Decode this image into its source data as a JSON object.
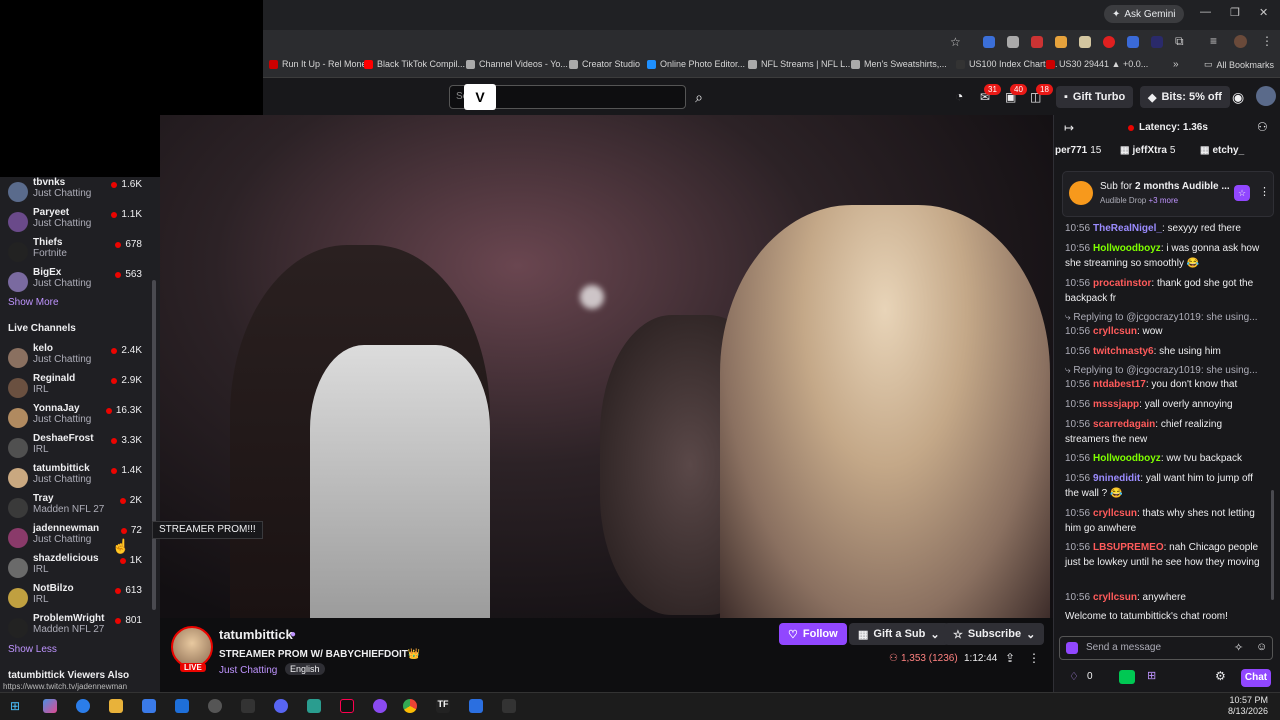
{
  "browser": {
    "gemini_label": "Ask Gemini",
    "bookmarks": [
      {
        "label": "Run It Up - Rel Money",
        "color": "#cc0000"
      },
      {
        "label": "Black TikTok Compil...",
        "color": "#ff0000"
      },
      {
        "label": "Channel Videos - Yo...",
        "color": "#aaaaaa"
      },
      {
        "label": "Creator Studio",
        "color": "#aaaaaa"
      },
      {
        "label": "Online Photo Editor...",
        "color": "#1e90ff"
      },
      {
        "label": "NFL Streams | NFL L...",
        "color": "#aaaaaa"
      },
      {
        "label": "Men's Sweatshirts,...",
        "color": "#aaaaaa"
      },
      {
        "label": "US100 Index Charts...",
        "color": "#333333"
      },
      {
        "label": "US30 29441 ▲ +0.0...",
        "color": "#cc0000"
      }
    ],
    "all_bookmarks": "All Bookmarks",
    "status_url": "https://www.twitch.tv/jadennewman"
  },
  "topnav": {
    "search_placeholder": "Search",
    "badges": [
      "31",
      "40",
      "18"
    ],
    "gift_turbo": "Gift Turbo",
    "bits": "Bits: 5% off"
  },
  "sidebar": {
    "followed": [
      {
        "name": "tbvnks",
        "game": "Just Chatting",
        "viewers": "1.6K",
        "color": "#5a6b8c"
      },
      {
        "name": "Paryeet",
        "game": "Just Chatting",
        "viewers": "1.1K",
        "color": "#6a4a8a"
      },
      {
        "name": "Thiefs",
        "game": "Fortnite",
        "viewers": "678",
        "color": "#222222"
      },
      {
        "name": "BigEx",
        "game": "Just Chatting",
        "viewers": "563",
        "color": "#7a6aa0"
      }
    ],
    "show_more": "Show More",
    "live_header": "Live Channels",
    "live": [
      {
        "name": "kelo",
        "game": "Just Chatting",
        "viewers": "2.4K",
        "color": "#8a7060"
      },
      {
        "name": "Reginald",
        "game": "IRL",
        "viewers": "2.9K",
        "color": "#6a5040"
      },
      {
        "name": "YonnaJay",
        "game": "Just Chatting",
        "viewers": "16.3K",
        "color": "#b08a60"
      },
      {
        "name": "DeshaeFrost",
        "game": "IRL",
        "viewers": "3.3K",
        "color": "#505050"
      },
      {
        "name": "tatumbittick",
        "game": "Just Chatting",
        "viewers": "1.4K",
        "color": "#c9a880"
      },
      {
        "name": "Tray",
        "game": "Madden NFL 27",
        "viewers": "2K",
        "color": "#3a3a3a"
      },
      {
        "name": "jadennewman",
        "game": "Just Chatting",
        "viewers": "72",
        "color": "#8a3a6a"
      },
      {
        "name": "shazdelicious",
        "game": "IRL",
        "viewers": "1K",
        "color": "#6a6a6a"
      },
      {
        "name": "NotBilzo",
        "game": "IRL",
        "viewers": "613",
        "color": "#c0a040"
      },
      {
        "name": "ProblemWright",
        "game": "Madden NFL 27",
        "viewers": "801",
        "color": "#222222"
      }
    ],
    "show_less": "Show Less",
    "viewers_also": "tatumbittick Viewers Also",
    "tooltip": "STREAMER PROM!!!"
  },
  "stream": {
    "channel": "tatumbittick",
    "title": "STREAMER PROM W/ BABYCHIEFDOIT👑",
    "category": "Just Chatting",
    "tag": "English",
    "live": "LIVE",
    "viewers": "1,353 (1236)",
    "uptime": "1:12:44",
    "follow": "Follow",
    "gift_sub": "Gift a Sub",
    "subscribe": "Subscribe"
  },
  "chat": {
    "latency": "Latency: 1.36s",
    "gifters": [
      {
        "name": "per771",
        "count": "15"
      },
      {
        "name": "jeffXtra",
        "count": "5"
      },
      {
        "name": "etchy_",
        "count": ""
      }
    ],
    "audible_title_pre": "Sub for ",
    "audible_title_bold": "2 months Audible ...",
    "audible_sub": "Audible Drop",
    "audible_more": "+3 more",
    "messages": [
      {
        "time": "10:56",
        "user": "TheRealNigel_",
        "color": "#9b8cff",
        "text": "sexyyy red there",
        "reply": ""
      },
      {
        "time": "10:56",
        "user": "Hollwoodboyz",
        "color": "#7fff00",
        "text": "i was gonna ask how she streaming so smoothly 😂",
        "reply": ""
      },
      {
        "time": "10:56",
        "user": "procatinstor",
        "color": "#ff5b5b",
        "text": "thank god she got the backpack fr",
        "reply": ""
      },
      {
        "time": "10:56",
        "user": "cryllcsun",
        "color": "#ff5b5b",
        "text": "wow",
        "reply": "Replying to @jcgocrazy1019: she using..."
      },
      {
        "time": "10:56",
        "user": "twitchnasty6",
        "color": "#ff5b5b",
        "text": "she using him",
        "reply": ""
      },
      {
        "time": "10:56",
        "user": "ntdabest17",
        "color": "#ff5b5b",
        "text": "you don't know that",
        "reply": "Replying to @jcgocrazy1019: she using..."
      },
      {
        "time": "10:56",
        "user": "msssjapp",
        "color": "#ff5b5b",
        "text": "yall overly annoying",
        "reply": ""
      },
      {
        "time": "10:56",
        "user": "scarredagain",
        "color": "#ff5b5b",
        "text": "chief realizing streamers the new",
        "reply": ""
      },
      {
        "time": "10:56",
        "user": "Hollwoodboyz",
        "color": "#7fff00",
        "text": "ww tvu backpack",
        "reply": ""
      },
      {
        "time": "10:56",
        "user": "9ninedidit",
        "color": "#9b8cff",
        "text": "yall want him to jump off the wall ? 😂",
        "reply": ""
      },
      {
        "time": "10:56",
        "user": "cryllcsun",
        "color": "#ff5b5b",
        "text": "thats why shes not letting him go anwhere",
        "reply": ""
      },
      {
        "time": "10:56",
        "user": "LBSUPREMEO",
        "color": "#ff5b5b",
        "text": "nah Chicago people just be lowkey until he see how they moving",
        "reply": ""
      },
      {
        "time": "10:56",
        "user": "cryllcsun",
        "color": "#ff5b5b",
        "text": "anywhere",
        "reply": ""
      }
    ],
    "welcome": "Welcome to tatumbittick's chat room!",
    "input_placeholder": "Send a message",
    "points": "0",
    "chat_button": "Chat"
  },
  "taskbar": {
    "time": "10:57 PM",
    "date": "8/13/2026"
  }
}
